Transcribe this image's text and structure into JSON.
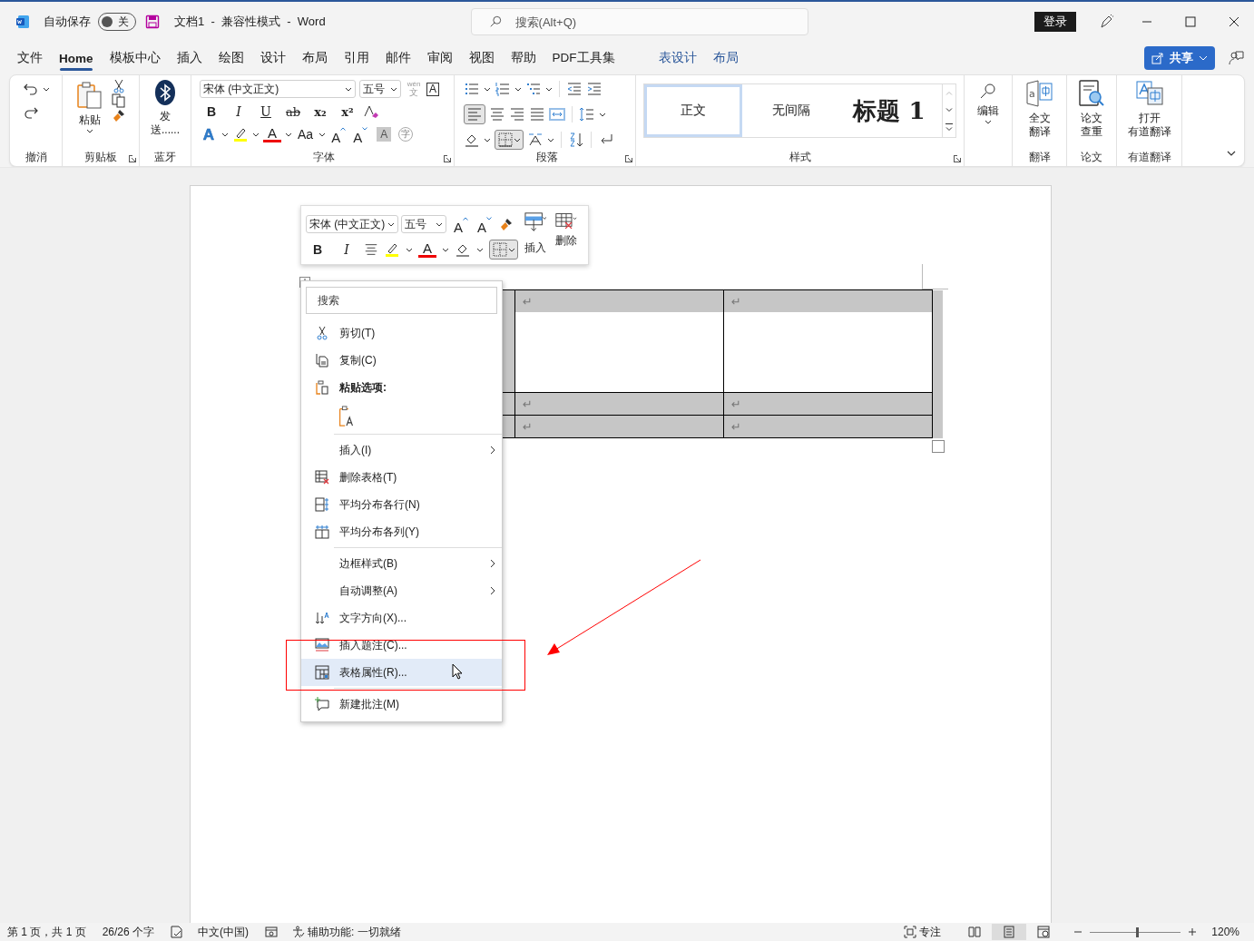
{
  "title_bar": {
    "autosave_label": "自动保存",
    "autosave_toggle": {
      "label": "关",
      "on": false
    },
    "document_title": "文档1  -  兼容性模式  -  Word",
    "search": {
      "placeholder": "搜索(Alt+Q)"
    },
    "login_button": "登录"
  },
  "menu_tabs": [
    {
      "label": "文件",
      "selected": false,
      "kind": "normal"
    },
    {
      "label": "Home",
      "selected": true,
      "kind": "normal"
    },
    {
      "label": "模板中心",
      "selected": false,
      "kind": "normal"
    },
    {
      "label": "插入",
      "selected": false,
      "kind": "normal"
    },
    {
      "label": "绘图",
      "selected": false,
      "kind": "normal"
    },
    {
      "label": "设计",
      "selected": false,
      "kind": "normal"
    },
    {
      "label": "布局",
      "selected": false,
      "kind": "normal"
    },
    {
      "label": "引用",
      "selected": false,
      "kind": "normal"
    },
    {
      "label": "邮件",
      "selected": false,
      "kind": "normal"
    },
    {
      "label": "审阅",
      "selected": false,
      "kind": "normal"
    },
    {
      "label": "视图",
      "selected": false,
      "kind": "normal"
    },
    {
      "label": "帮助",
      "selected": false,
      "kind": "normal"
    },
    {
      "label": "PDF工具集",
      "selected": false,
      "kind": "normal"
    },
    {
      "label": "表设计",
      "selected": false,
      "kind": "context"
    },
    {
      "label": "布局",
      "selected": false,
      "kind": "context"
    }
  ],
  "share_button": "共享",
  "ribbon": {
    "undo": {
      "label": "撤消"
    },
    "clipboard": {
      "label": "剪贴板",
      "paste": "粘贴"
    },
    "bluetooth": {
      "label": "蓝牙",
      "send_lines": [
        "发",
        "送......"
      ]
    },
    "font": {
      "label": "字体",
      "font_name": "宋体 (中文正文)",
      "font_size": "五号",
      "phonetic_ruby": "wén",
      "phonetic_base": "文",
      "char_border": "A",
      "format_buttons": [
        "B",
        "I",
        "U",
        "ab",
        "x₂",
        "x²"
      ],
      "text_effect": "A",
      "font_color": "A",
      "change_case": "Aa",
      "grow_font": "A",
      "shrink_font": "A",
      "char_shading": "A",
      "enclose_char": "字"
    },
    "paragraph": {
      "label": "段落",
      "align_left_selected": true
    },
    "styles": {
      "label": "样式",
      "items": [
        {
          "label": "正文",
          "selected": true,
          "kind": "normal"
        },
        {
          "label": "无间隔",
          "selected": false,
          "kind": "normal"
        },
        {
          "label": "标题 1",
          "selected": false,
          "kind": "heading"
        }
      ]
    },
    "editing": {
      "label": "编辑"
    },
    "translate": {
      "label": "翻译",
      "icon_letter": "a",
      "button_lines": [
        "全文",
        "翻译"
      ]
    },
    "paper": {
      "label": "论文",
      "button_lines": [
        "论文",
        "查重"
      ]
    },
    "youdao": {
      "label": "有道翻译",
      "button_lines": [
        "打开",
        "有道翻译"
      ]
    }
  },
  "mini_toolbar": {
    "font_name": "宋体 (中文正文)",
    "font_size": "五号",
    "grow_font": "A",
    "shrink_font": "A",
    "insert": "插入",
    "delete": "删除",
    "bold": "B",
    "italic": "I",
    "font_color": "A"
  },
  "table": {
    "rows": [
      {
        "selected": true,
        "tall": true,
        "cells": [
          "↵",
          "↵"
        ]
      },
      {
        "selected": true,
        "tall": false,
        "cells": [
          "↵",
          "↵"
        ]
      },
      {
        "selected": true,
        "tall": false,
        "cells": [
          "↵",
          "↵"
        ]
      }
    ]
  },
  "context_menu": {
    "search": {
      "placeholder": "搜索"
    },
    "items": [
      {
        "kind": "cut",
        "label": "剪切(T)",
        "selected": false
      },
      {
        "kind": "copy",
        "label": "复制(C)",
        "selected": false
      },
      {
        "kind": "pasteheader",
        "label": "粘贴选项:",
        "selected": false
      },
      {
        "kind": "pasteoption",
        "selected": false
      },
      {
        "kind": "separator"
      },
      {
        "kind": "submenu",
        "label": "插入(I)",
        "selected": false
      },
      {
        "kind": "deletetable",
        "label": "删除表格(T)",
        "selected": false
      },
      {
        "kind": "rows",
        "label": "平均分布各行(N)",
        "selected": false
      },
      {
        "kind": "columns",
        "label": "平均分布各列(Y)",
        "selected": false
      },
      {
        "kind": "separator"
      },
      {
        "kind": "submenu",
        "label": "边框样式(B)",
        "selected": false
      },
      {
        "kind": "submenu",
        "label": "自动调整(A)",
        "selected": false
      },
      {
        "kind": "direction",
        "label": "文字方向(X)...",
        "selected": false
      },
      {
        "kind": "caption",
        "label": "插入题注(C)...",
        "selected": false
      },
      {
        "kind": "properties",
        "label": "表格属性(R)...",
        "selected": true
      },
      {
        "kind": "separator"
      },
      {
        "kind": "comment",
        "label": "新建批注(M)",
        "selected": false
      }
    ]
  },
  "status_bar": {
    "page": "第 1 页，共 1 页",
    "words": "26/26 个字",
    "language": "中文(中国)",
    "accessibility": "辅助功能: 一切就绪",
    "focus": "专注",
    "views": [
      {
        "kind": "read",
        "selected": false
      },
      {
        "kind": "print",
        "selected": true
      },
      {
        "kind": "web",
        "selected": false
      }
    ],
    "zoom": {
      "level": 0.52,
      "reading": "120%"
    }
  }
}
